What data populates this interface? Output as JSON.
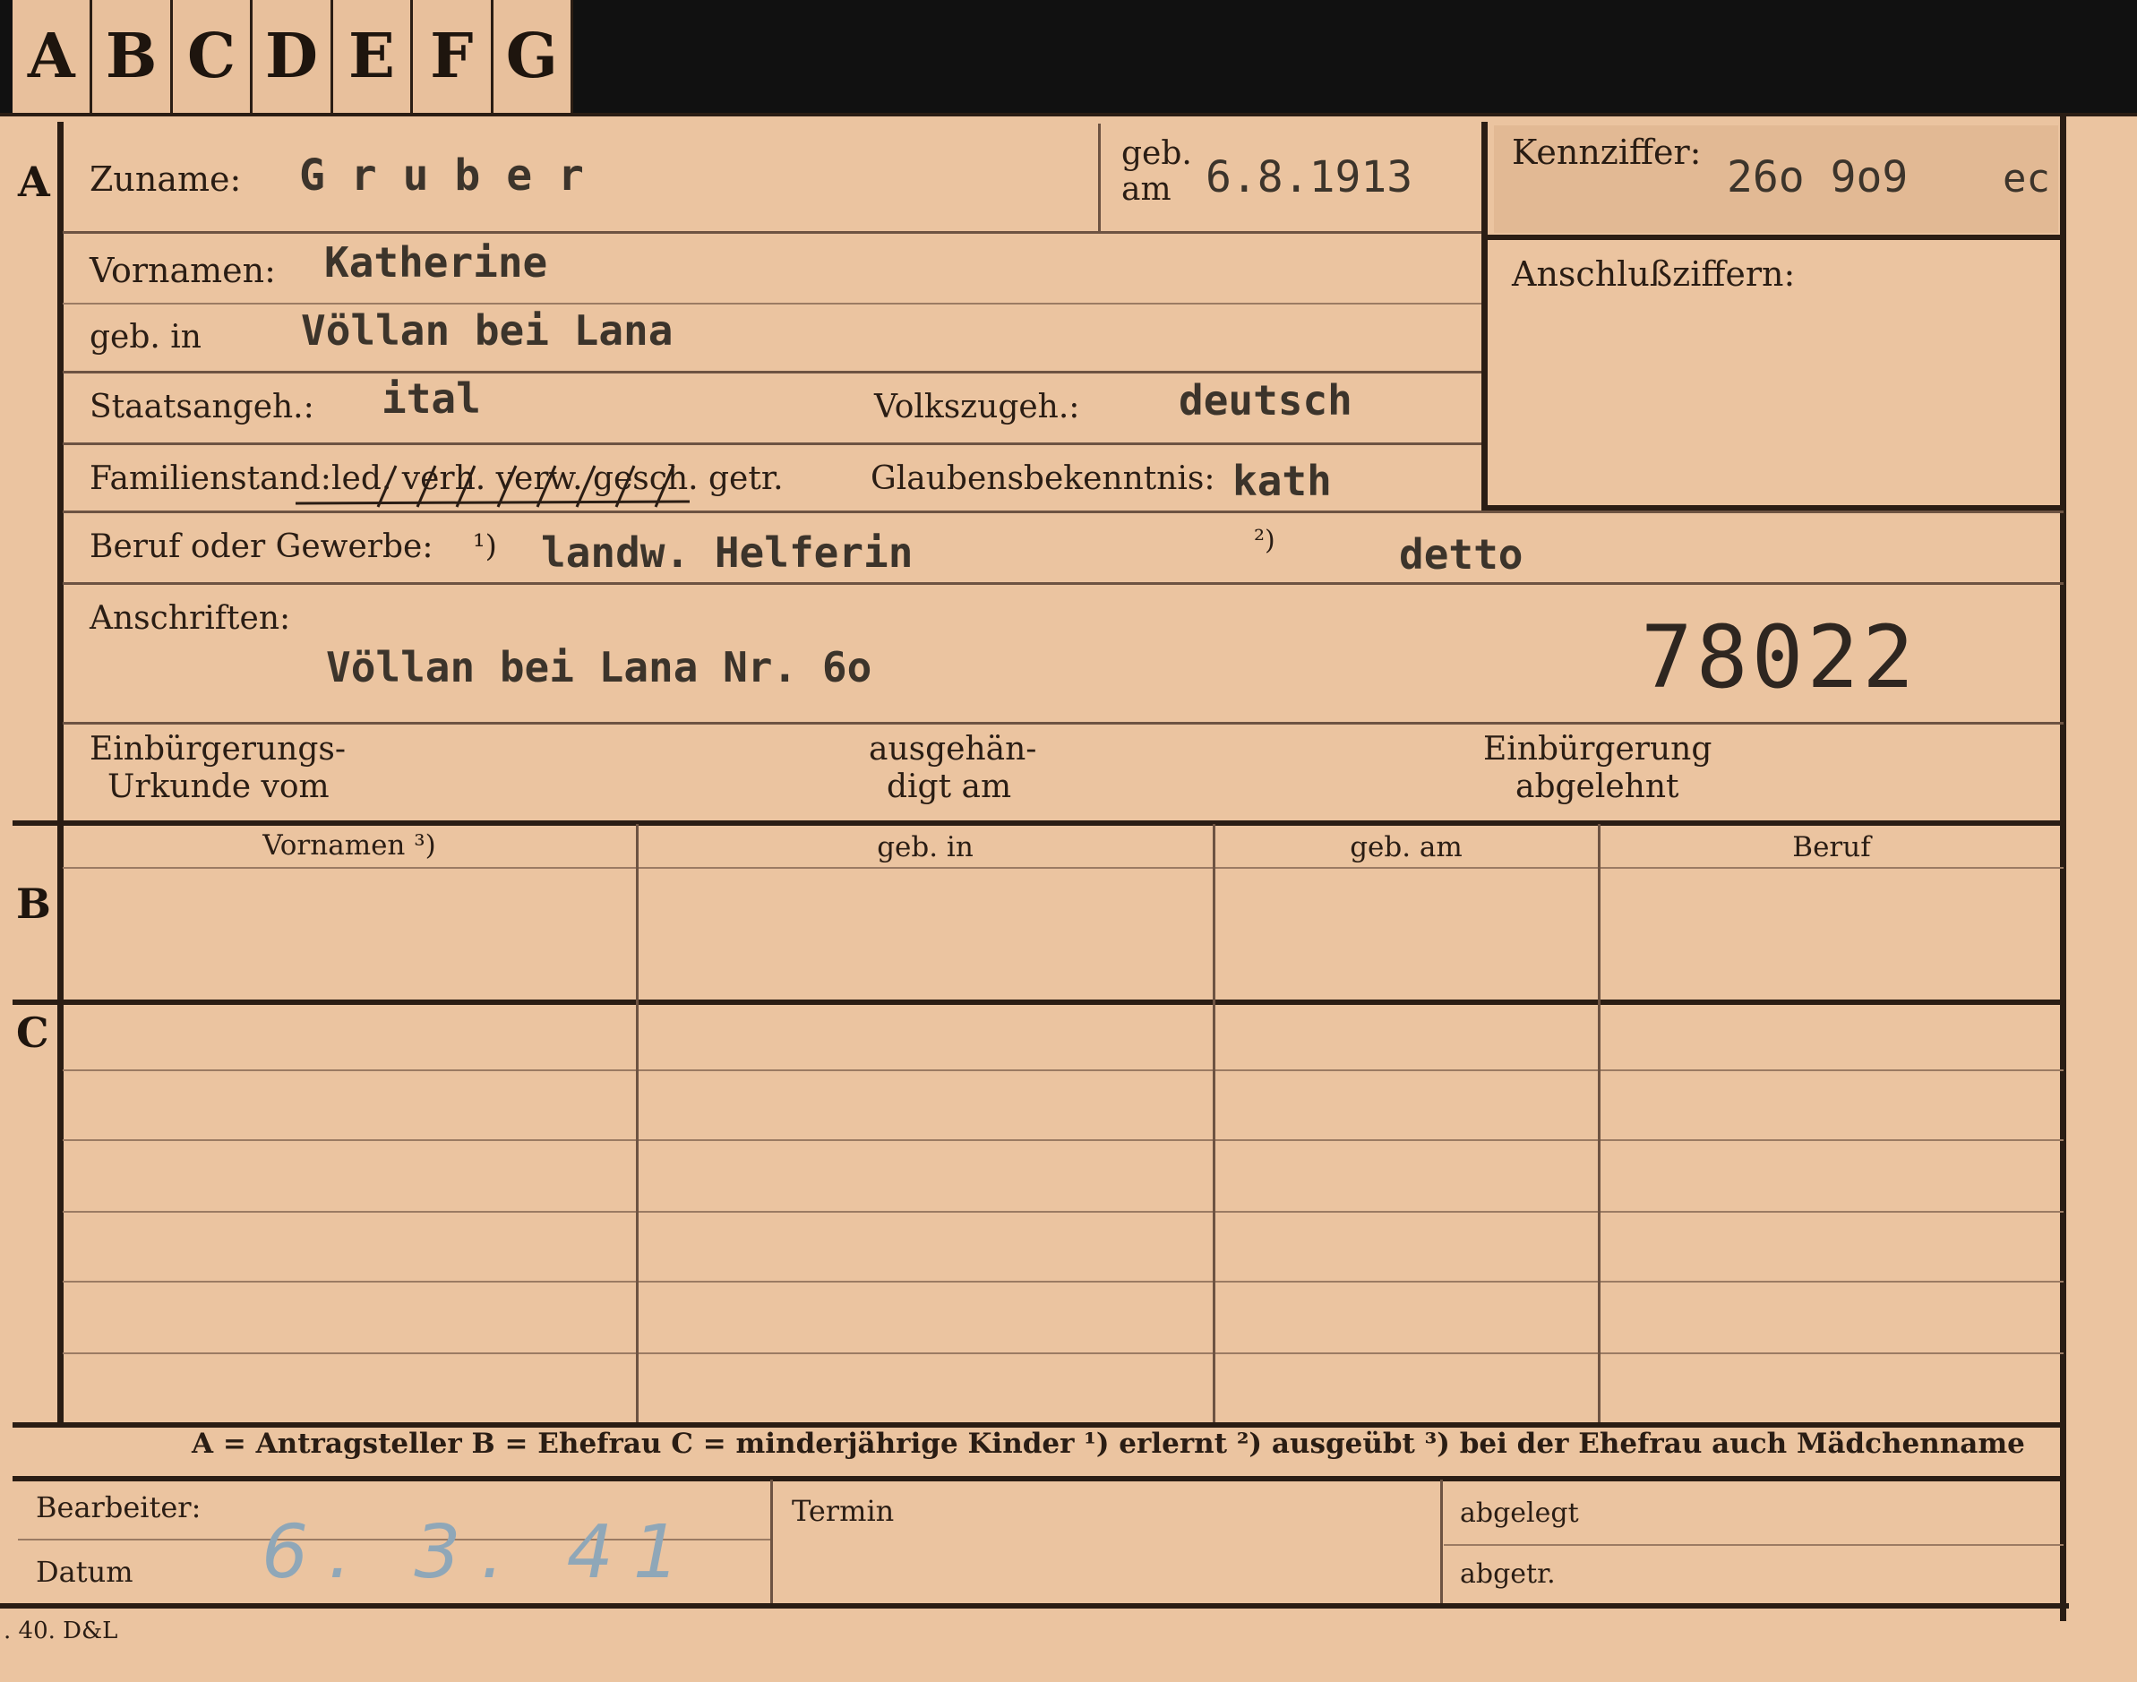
{
  "tabs": [
    "A",
    "B",
    "C",
    "D",
    "E",
    "F",
    "G"
  ],
  "sections": {
    "a": "A",
    "b": "B",
    "c": "C"
  },
  "person": {
    "surname_label": "Zuname:",
    "surname": "G r u b e r",
    "birthdate_label_1": "geb.",
    "birthdate_label_2": "am",
    "birthdate": "6.8.1913",
    "first_names_label": "Vornamen:",
    "first_names": "Katherine",
    "birthplace_label": "geb. in",
    "birthplace": "Völlan bei Lana",
    "citizenship_label": "Staatsangeh.:",
    "citizenship": "ital",
    "ethnicity_label": "Volkszugeh.:",
    "ethnicity": "deutsch",
    "marital_label": "Familienstand:",
    "marital_options": "led. verh. verw. gesch. getr.",
    "religion_label": "Glaubensbekenntnis:",
    "religion": "kath",
    "profession_label": "Beruf oder Gewerbe:",
    "profession_mark_1": "¹)",
    "profession_learned": "landw. Helferin",
    "profession_mark_2": "²)",
    "profession_practised": "detto",
    "address_label": "Anschriften:",
    "address": "Völlan bei Lana Nr. 6o",
    "register_number": "78022",
    "naturalization_doc_label_1": "Einbürgerungs-",
    "naturalization_doc_label_2": "Urkunde vom",
    "handed_out_label_1": "ausgehän-",
    "handed_out_label_2": "digt am",
    "naturalization_refused_label_1": "Einbürgerung",
    "naturalization_refused_label_2": "abgelehnt"
  },
  "reference": {
    "code_label": "Kennziffer:",
    "code_value": "26o 9o9",
    "code_suffix": "ec",
    "linked_label": "Anschlußziffern:"
  },
  "family_table": {
    "headers": [
      "Vornamen ³)",
      "geb. in",
      "geb. am",
      "Beruf"
    ]
  },
  "legend": "A = Antragsteller   B = Ehefrau   C = minderjährige Kinder   ¹) erlernt   ²) ausgeübt   ³) bei der Ehefrau auch Mädchenname",
  "footer": {
    "clerk_label": "Bearbeiter:",
    "date_label": "Datum",
    "date_value": "6. 3. 41",
    "deadline_label": "Termin",
    "filed_label": "abgelegt",
    "deregistered_label": "abgetr."
  },
  "print_mark": ". 40. D&L"
}
